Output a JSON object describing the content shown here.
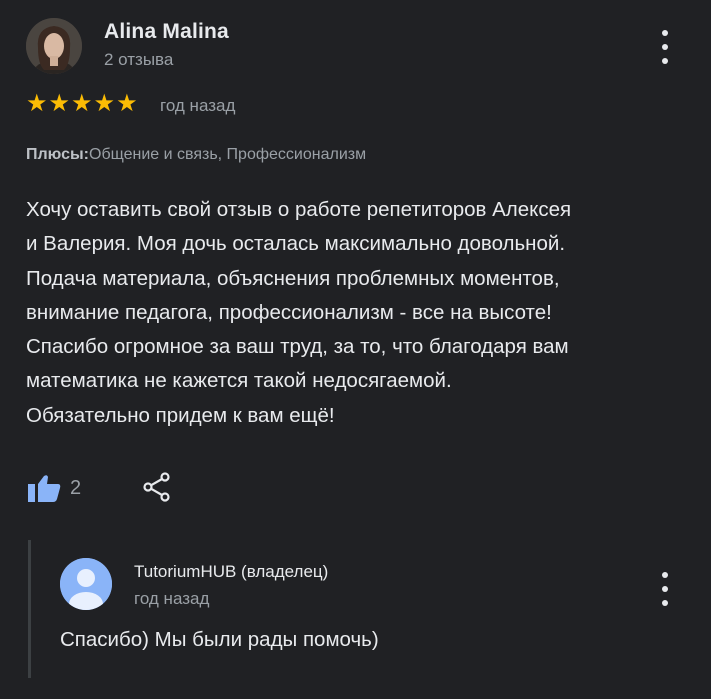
{
  "review": {
    "author": "Alina Malina",
    "reviews_count": "2 отзыва",
    "rating": 5,
    "date": "год назад",
    "pros_label": "Плюсы:",
    "pros_value": "Общение и связь, Профессионализм",
    "text": "Хочу оставить свой отзыв о работе репетиторов Алексея\nи Валерия. Моя дочь осталась максимально довольной.\nПодача материала, объяснения проблемных моментов,\nвнимание педагога, профессионализм - все на высоте!\nСпасибо огромное за ваш труд, за то, что благодаря вам\nматематика не кажется такой недосягаемой.\nОбязательно придем к вам ещё!",
    "likes": "2"
  },
  "reply": {
    "author": "TutoriumHUB (владелец)",
    "date": "год назад",
    "text": "Спасибо) Мы были рады помочь)"
  },
  "colors": {
    "background": "#202124",
    "star": "#fbbc04",
    "secondary_text": "#9aa0a6",
    "owner_avatar": "#8ab4f8"
  },
  "icons": {
    "avatar": "user-photo",
    "menu": "more-vert-icon",
    "like": "thumbs-up-icon",
    "share": "share-icon",
    "owner_avatar": "person-icon"
  }
}
